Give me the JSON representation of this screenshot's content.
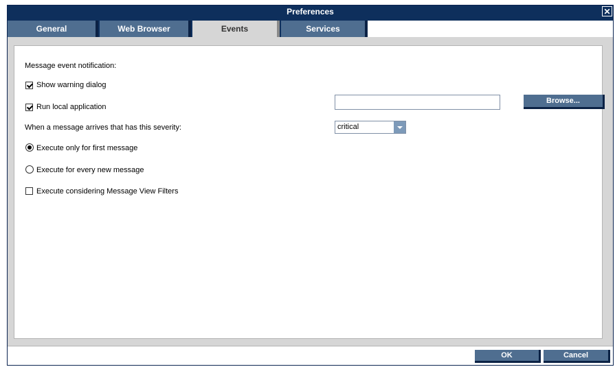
{
  "window": {
    "title": "Preferences",
    "close_glyph": "✕"
  },
  "tabs": [
    {
      "label": "General",
      "active": false
    },
    {
      "label": "Web Browser",
      "active": false
    },
    {
      "label": "Events",
      "active": true
    },
    {
      "label": "Services",
      "active": false
    }
  ],
  "events": {
    "section_label": "Message event notification:",
    "show_warning": {
      "label": "Show warning dialog",
      "checked": true
    },
    "run_local": {
      "label": "Run local application",
      "checked": true,
      "value": ""
    },
    "browse_label": "Browse...",
    "severity_label": "When a message arrives that has this severity:",
    "severity_value": "critical",
    "radio_first": {
      "label": "Execute only for first message",
      "checked": true
    },
    "radio_every": {
      "label": "Execute for every new message",
      "checked": false
    },
    "filters": {
      "label": "Execute considering Message View Filters",
      "checked": false
    }
  },
  "footer": {
    "ok_label": "OK",
    "cancel_label": "Cancel"
  },
  "colors": {
    "titlebar": "#0e2f5c",
    "tab": "#4f6e90",
    "tab_active": "#d6d6d6",
    "button": "#4f6e90"
  }
}
